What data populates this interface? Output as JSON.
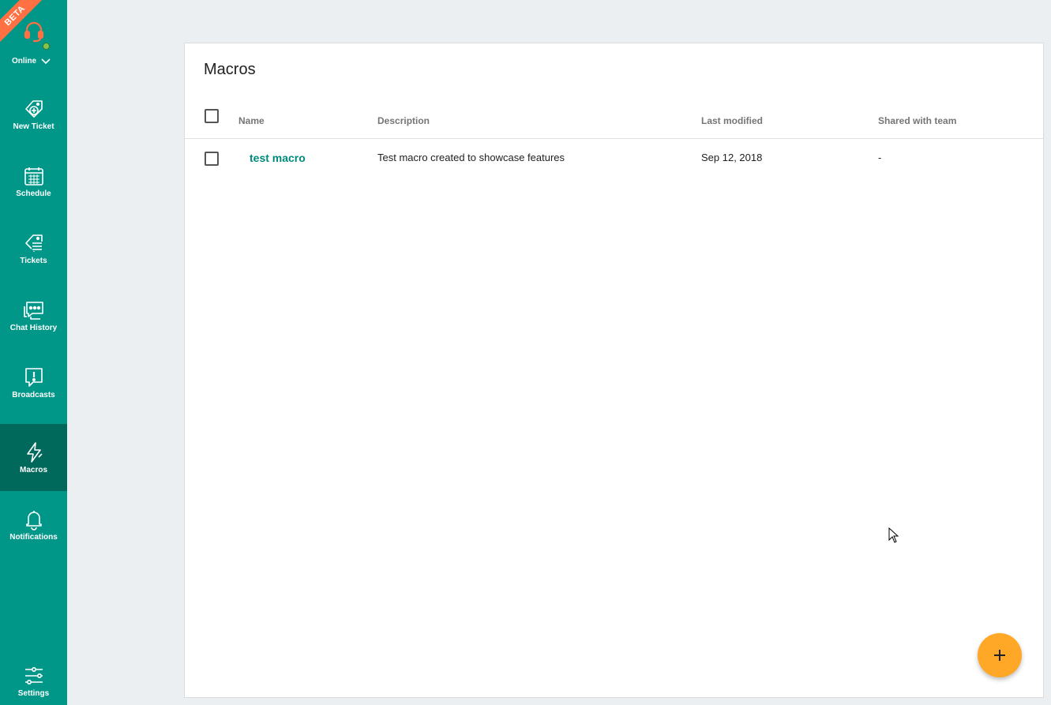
{
  "sidebar": {
    "beta_label": "BETA",
    "status": {
      "label": "Online",
      "dot_color": "#8bc34a"
    },
    "items": [
      {
        "label": "New Ticket",
        "icon": "new-ticket-icon"
      },
      {
        "label": "Schedule",
        "icon": "calendar-icon"
      },
      {
        "label": "Tickets",
        "icon": "tickets-icon"
      },
      {
        "label": "Chat History",
        "icon": "chat-history-icon"
      },
      {
        "label": "Broadcasts",
        "icon": "broadcast-icon"
      },
      {
        "label": "Macros",
        "icon": "lightning-icon",
        "active": true
      },
      {
        "label": "Notifications",
        "icon": "bell-icon"
      }
    ],
    "settings": {
      "label": "Settings",
      "icon": "sliders-icon"
    }
  },
  "colors": {
    "sidebar": "#009688",
    "sidebar_active": "#00695c",
    "accent_link": "#00897b",
    "fab": "#ffa726",
    "beta_ribbon": "#ff7043"
  },
  "main": {
    "title": "Macros",
    "table": {
      "columns": [
        "Name",
        "Description",
        "Last modified",
        "Shared with team"
      ],
      "rows": [
        {
          "name": "test macro",
          "description": "Test macro created to showcase features",
          "last_modified": "Sep 12, 2018",
          "shared": "-"
        }
      ]
    },
    "fab_icon": "plus-icon"
  }
}
